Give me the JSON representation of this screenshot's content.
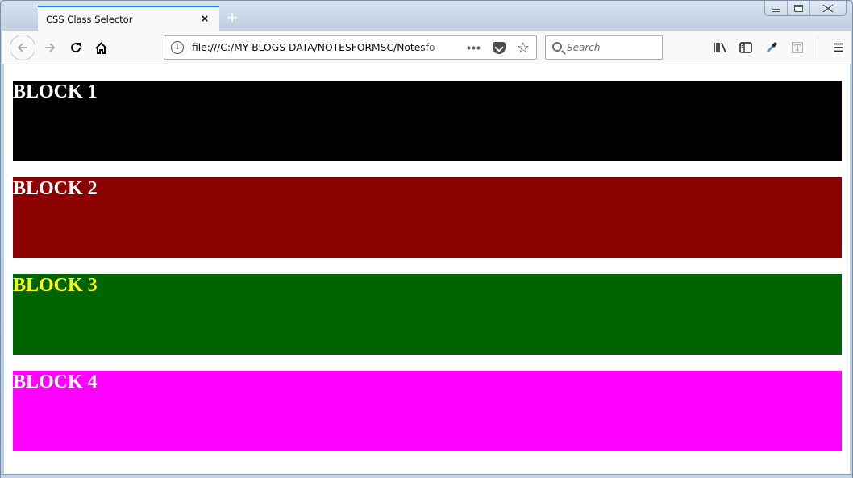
{
  "browser": {
    "tab": {
      "title": "CSS Class Selector",
      "close_icon": "×"
    },
    "new_tab_label": "+",
    "window_controls": [
      "minimize",
      "maximize",
      "close"
    ],
    "nav": {
      "back_icon": "←",
      "forward_icon": "→",
      "reload_icon": "↻",
      "home_icon": "⌂"
    },
    "url": "file:///C:/MY BLOGS DATA/NOTESFORMSC/Notesfo",
    "url_info_icon": "i",
    "page_actions_icon": "•••",
    "bookmark_icon": "☆",
    "search": {
      "placeholder": "Search"
    },
    "toolbar_icons": {
      "library": "|||\\",
      "sidebar": "▯",
      "eyedropper": "✎",
      "reader": "T",
      "menu": "☰"
    }
  },
  "page": {
    "blocks": [
      {
        "label": "BLOCK 1",
        "background": "#000000",
        "color": "#ffffff"
      },
      {
        "label": "BLOCK 2",
        "background": "#8b0000",
        "color": "#ffffff"
      },
      {
        "label": "BLOCK 3",
        "background": "#006400",
        "color": "#ffff00"
      },
      {
        "label": "BLOCK 4",
        "background": "#ff00ff",
        "color": "#ffffff"
      }
    ]
  }
}
